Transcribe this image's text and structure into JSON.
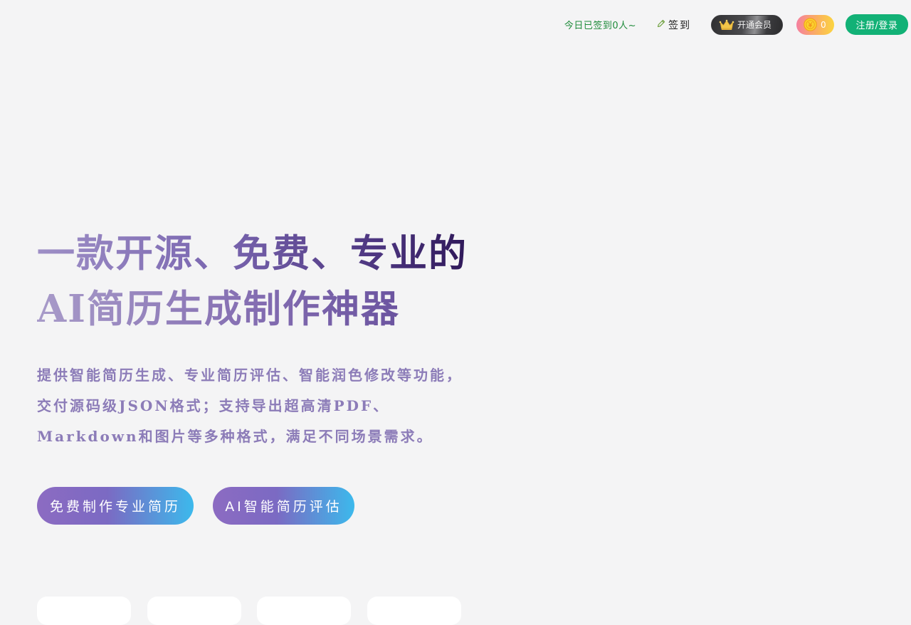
{
  "header": {
    "checkin_count": "今日已签到0人~",
    "sign_label": "签到",
    "vip_label": "开通会员",
    "coin_balance": "0",
    "login_label": "注册/登录"
  },
  "hero": {
    "title_line1": "一款开源、免费、专业的",
    "title_line2": "AI简历生成制作神器",
    "description": "提供智能简历生成、专业简历评估、智能润色修改等功能，交付源码级JSON格式；支持导出超高清PDF、Markdown和图片等多种格式，满足不同场景需求。",
    "cta_primary": "免费制作专业简历",
    "cta_secondary": "AI智能简历评估"
  },
  "icons": {
    "sign": "pencil-icon",
    "vip": "crown-icon",
    "coin": "coin-icon"
  },
  "colors": {
    "page_bg": "#f4f4f5",
    "checkin_text": "#1e8b3a",
    "login_bg": "#12b176",
    "desc_text": "#8c7cb8",
    "title_dark": "#27104f",
    "title_light": "#9e8fc6",
    "cta_start": "#8c6bc2",
    "cta_end": "#3cb9ec"
  }
}
